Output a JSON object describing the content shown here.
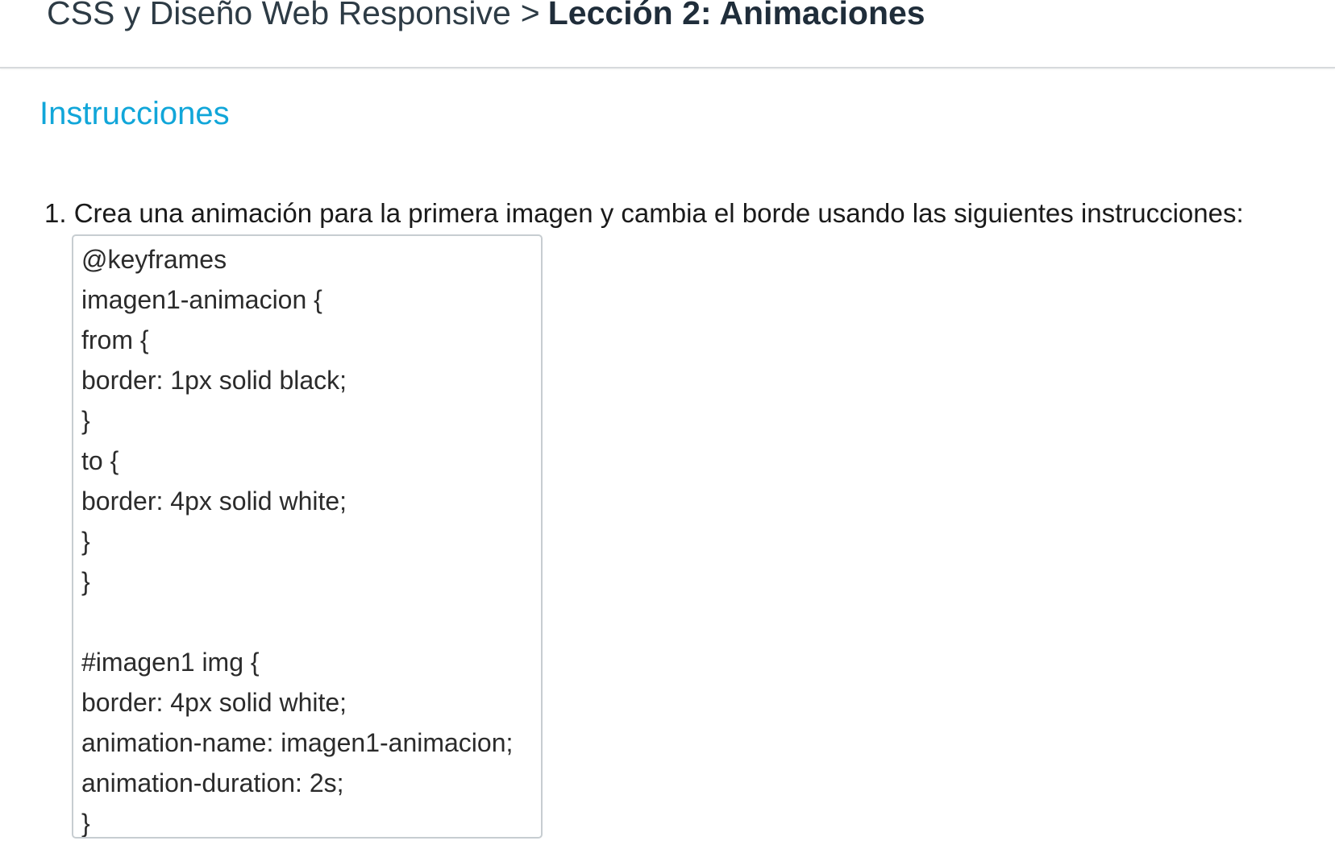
{
  "header": {
    "course": "CSS y Diseño Web Responsive",
    "separator": ">",
    "current": "Lección 2: Animaciones"
  },
  "main": {
    "section_title": "Instrucciones",
    "instructions": [
      {
        "number": "1.",
        "text": "Crea una animación para la primera imagen y cambia el borde usando las siguientes instrucciones:",
        "code_lines": [
          "@keyframes",
          "imagen1-animacion {",
          "from {",
          "border: 1px solid black;",
          "}",
          "to {",
          "border: 4px solid white;",
          "}",
          "}",
          "",
          "#imagen1 img {",
          "border: 4px solid white;",
          "animation-name: imagen1-animacion;",
          "animation-duration: 2s;",
          "}"
        ]
      }
    ]
  },
  "colors": {
    "section_title": "#11a6d9",
    "breadcrumb_text": "#2d3b45",
    "header_border": "#d7dadc",
    "code_border": "#c7cdd1"
  }
}
